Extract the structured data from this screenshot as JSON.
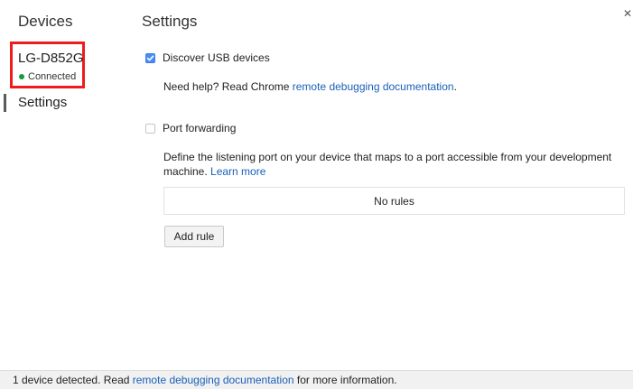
{
  "sidebar": {
    "title": "Devices",
    "device": {
      "name": "LG-D852G",
      "status": "Connected"
    },
    "settings_label": "Settings"
  },
  "main": {
    "title": "Settings",
    "discover_usb": {
      "label": "Discover USB devices",
      "checked": true
    },
    "help": {
      "prefix": "Need help? Read Chrome ",
      "link": "remote debugging documentation",
      "suffix": "."
    },
    "port_forwarding": {
      "label": "Port forwarding",
      "checked": false
    },
    "description": {
      "text": "Define the listening port on your device that maps to a port accessible from your development machine. ",
      "link": "Learn more"
    },
    "rules_empty": "No rules",
    "add_rule_label": "Add rule"
  },
  "footer": {
    "prefix": "1 device detected. Read ",
    "link": "remote debugging documentation",
    "suffix": " for more information."
  },
  "icons": {
    "close": "close-icon",
    "check": "check-icon",
    "status": "status-dot-icon"
  },
  "colors": {
    "highlight_border": "#ee1c1c",
    "link": "#1a5fb8",
    "checkbox_checked": "#4a8bf5",
    "status_connected": "#139c3b"
  }
}
